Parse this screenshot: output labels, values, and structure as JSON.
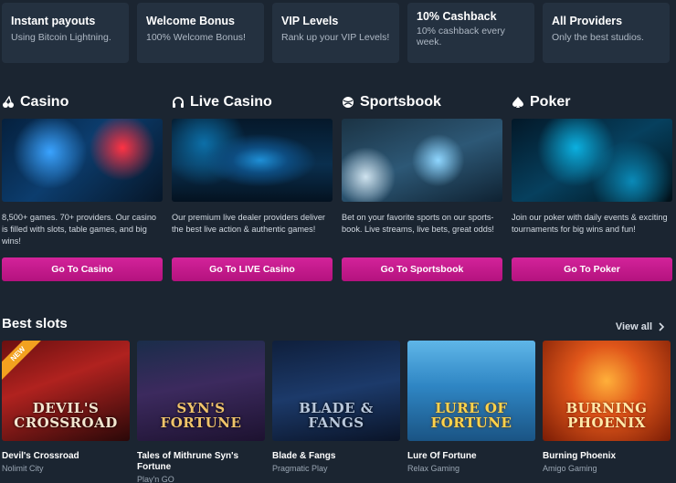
{
  "features": [
    {
      "title": "Instant payouts",
      "subtitle": "Using Bitcoin Lightning."
    },
    {
      "title": "Welcome Bonus",
      "subtitle": "100% Welcome Bonus!"
    },
    {
      "title": "VIP Levels",
      "subtitle": "Rank up your VIP Levels!"
    },
    {
      "title": "10% Cashback",
      "subtitle": "10% cashback every week."
    },
    {
      "title": "All Providers",
      "subtitle": "Only the best studios."
    }
  ],
  "categories": [
    {
      "title": "Casino",
      "icon": "cherries-icon",
      "description": "8,500+ games. 70+ providers. Our casino is filled with slots, table games, and big wins!",
      "button": "Go To Casino"
    },
    {
      "title": "Live Casino",
      "icon": "headset-icon",
      "description": "Our premium live dealer providers deliver the best live action & authentic games!",
      "button": "Go To LIVE Casino"
    },
    {
      "title": "Sportsbook",
      "icon": "sports-ball-icon",
      "description": "Bet on your favorite sports on our sports-book. Live streams, live bets, great odds!",
      "button": "Go To Sportsbook"
    },
    {
      "title": "Poker",
      "icon": "spade-icon",
      "description": "Join our poker with daily events & exciting tournaments for big wins and fun!",
      "button": "Go To Poker"
    }
  ],
  "best_slots": {
    "title": "Best slots",
    "view_all": "View all",
    "items": [
      {
        "name": "Devil's Crossroad",
        "provider": "Nolimit City",
        "logo": "DEVIL'S CROSSROAD",
        "badge": "NEW"
      },
      {
        "name": "Tales of Mithrune Syn's Fortune",
        "provider": "Play'n GO",
        "logo": "SYN'S FORTUNE"
      },
      {
        "name": "Blade & Fangs",
        "provider": "Pragmatic Play",
        "logo": "BLADE & FANGS"
      },
      {
        "name": "Lure Of Fortune",
        "provider": "Relax Gaming",
        "logo": "LURE OF FORTUNE"
      },
      {
        "name": "Burning Phoenix",
        "provider": "Amigo Gaming",
        "logo": "BURNING PHOENIX"
      }
    ]
  }
}
